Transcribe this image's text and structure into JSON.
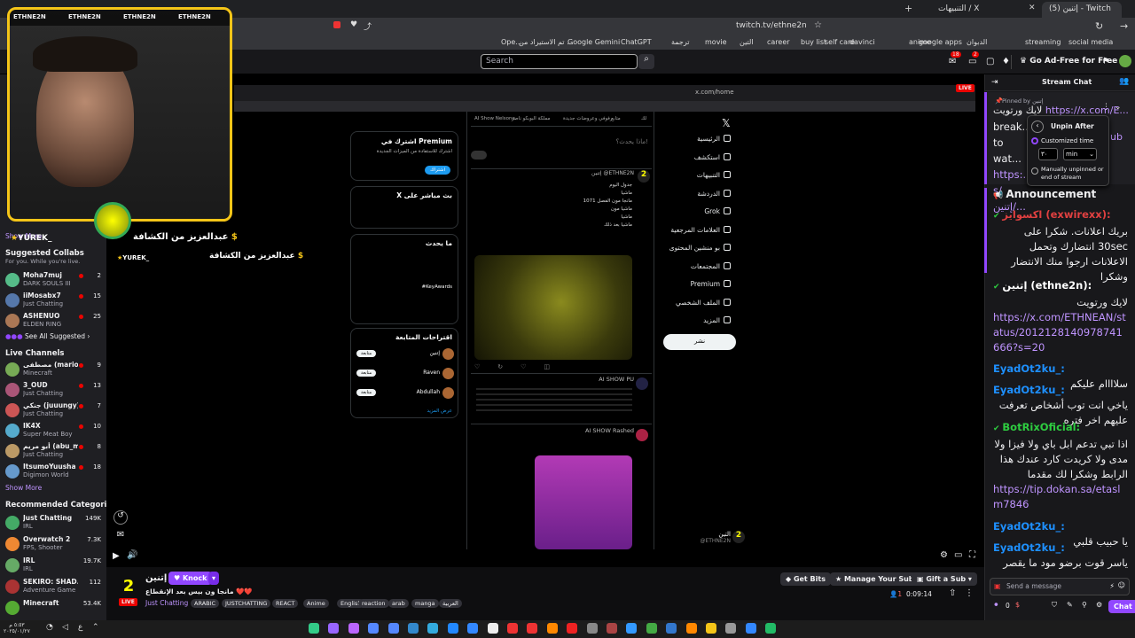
{
  "browser": {
    "tabs": [
      {
        "label": "(5) إتنين - Twitch",
        "active": true
      },
      {
        "label": "التنبيهات / X",
        "active": false
      }
    ],
    "url": "twitch.tv/ethne2n",
    "bookmarks": [
      "social media",
      "streaming",
      "الدبوان",
      "google apps",
      "anime",
      "davinci",
      "self care",
      "buy list",
      "career",
      "التين",
      "movie",
      "ترجمة",
      "ChatGPT",
      "Google Gemini",
      "تم الاستيراد من ...",
      "Ope..."
    ]
  },
  "twitch_header": {
    "search_placeholder": "Search",
    "notifications_count": "18",
    "whispers_count": "2",
    "ad_free_label": "Go Ad-Free for Free"
  },
  "sidebar": {
    "show_more_top": "Show More",
    "suggested_title": "Suggested Collabs",
    "suggested_sub": "For you. While you're live.",
    "suggested": [
      {
        "name": "Moha7muj",
        "game": "DARK SOULS III",
        "count": "2",
        "color": "#5b8"
      },
      {
        "name": "iiMosabx7",
        "game": "Just Chatting",
        "count": "15",
        "color": "#57a"
      },
      {
        "name": "ASHENUO",
        "game": "ELDEN RING",
        "count": "25",
        "color": "#a75"
      }
    ],
    "see_all": "See All Suggested",
    "live_title": "Live Channels",
    "live": [
      {
        "name": "مصطفى (mariona...)",
        "game": "Minecraft",
        "count": "9",
        "color": "#7a5"
      },
      {
        "name": "3_OUD",
        "game": "Just Chatting",
        "count": "13",
        "color": "#a57"
      },
      {
        "name": "جنكي (juuungy)",
        "game": "Just Chatting",
        "count": "7",
        "color": "#c55"
      },
      {
        "name": "IK4X",
        "game": "Super Meat Boy",
        "count": "10",
        "color": "#5ac"
      },
      {
        "name": "أبو مريم (abu_m...)",
        "game": "Just Chatting",
        "count": "8",
        "color": "#b96"
      },
      {
        "name": "ItsumoYuusha",
        "game": "Digimon World",
        "count": "18",
        "color": "#69c"
      }
    ],
    "show_more": "Show More",
    "rec_title": "Recommended Categories",
    "categories": [
      {
        "name": "Just Chatting",
        "game": "IRL",
        "count": "149K",
        "color": "#4a6"
      },
      {
        "name": "Overwatch 2",
        "game": "FPS, Shooter",
        "count": "7.3K",
        "color": "#e83"
      },
      {
        "name": "IRL",
        "game": "IRL",
        "count": "19.7K",
        "color": "#6a6"
      },
      {
        "name": "SEKIRO: SHAD...",
        "game": "Adventure Game",
        "count": "112",
        "color": "#a33"
      },
      {
        "name": "Minecraft",
        "game": "",
        "count": "53.4K",
        "color": "#5a3"
      }
    ]
  },
  "stream": {
    "webcam_names": [
      "ETHNE2N",
      "ETHNE2N",
      "ETHNE2N",
      "ETHNE2N"
    ],
    "overlay_text_1": "عبدالعزيز من الكشافة",
    "overlay_text_2": "عبدالعزيز من الكشافة",
    "overlay_user": "YUREK_",
    "overlay_user_2": "YUREK_",
    "vid_url": "x.com/home",
    "vid_live": "LIVE",
    "x_nav": [
      "الرئيسية",
      "استكشف",
      "التنبيهات",
      "الدردشة",
      "Grok",
      "العلامات المرجعية",
      "بو منشين المحتوى",
      "المجتمعات",
      "Premium",
      "الملف الشخصي",
      "المزيد"
    ],
    "x_post_button": "نشر",
    "x_tabs": [
      "لك",
      "متابع",
      "رفوفي وعروضات جديدة",
      "مملكة البوبكو ناصر",
      "AI Show Nelsone"
    ],
    "x_compose": "ماذا يحدث؟!",
    "x_post1_name": "إتنين @ETHNE2N",
    "x_post1_lines": [
      "جدول اليوم",
      "ماشيا",
      "مانجا مون الفصل 1071",
      "ماشيا مون",
      "ماشيا",
      "ماشيا بعد ذلك"
    ],
    "x_post2_name": "AI SHOW PU",
    "x_post3_name": "AI SHOW Rashed",
    "x_premium_title": "اشترك في Premium",
    "x_premium_text": "اشترك للاستفادة من الميزات الجديدة",
    "x_subscribe": "اشتراك",
    "x_live_title": "X بث مباشر على",
    "x_trends_title": "ما يحدث",
    "x_trend1": "#KeyAwards",
    "x_follow_title": "اقتراحات المتابعة",
    "x_follow": [
      "إتنين",
      "Raven",
      "Abdullah"
    ],
    "x_follow_btn": "متابعة",
    "x_show_more": "عرض المزيد",
    "x_streamer_name": "التين",
    "x_streamer_handle": "@ETHNE2N"
  },
  "info": {
    "viewers_rank": "2",
    "live": "LIVE",
    "channel_name": "إتنين",
    "knock": "Knock",
    "title": "مانجا ون بيس بعد الإنقطاع ❤️❤️",
    "category": "Just Chatting",
    "tags": [
      "ARABIC",
      "JUSTCHATTING",
      "REACT",
      "Anime",
      "English",
      "reaction",
      "arab",
      "manga",
      "العربية"
    ],
    "get_bits": "Get Bits",
    "manage_sub": "Manage Your Sub",
    "gift_sub": "Gift a Sub",
    "viewer_count": "1",
    "uptime": "0:09:14"
  },
  "chat": {
    "header": "Stream Chat",
    "pinned_by": "Pinned by إتنين",
    "pinned_text": "لايك ورتويت",
    "pinned_link": "https://x.com/E...",
    "pinned_lines": [
      "break...",
      "to wat...",
      "https:...",
      "s/إتنين/..."
    ],
    "popover_title": "Unpin After",
    "popover_opt1": "Customized time",
    "popover_num": "٣٠",
    "popover_unit": "min",
    "popover_opt2": "Manually unpinned or end of stream",
    "announcement": "Announcement",
    "messages": [
      {
        "user": "اكسوايز (exwirexx):",
        "user_color": "#e04040",
        "text": "بريك اعلانات. شكرا على 30sec انتضارك وتحمل الاعلانات ارجوا منك الانتضار وشكرا",
        "link": ""
      },
      {
        "user": "إتنين (ethne2n):",
        "user_color": "#ffffff",
        "text": "لايك ورتويت",
        "link": "https://x.com/ETHNEAN/status/2012128140978741666?s=20"
      },
      {
        "user": "EyadOt2ku_:",
        "user_color": "#1e90ff",
        "text": "سلاااام عليكم",
        "link": ""
      },
      {
        "user": "EyadOt2ku_:",
        "user_color": "#1e90ff",
        "text": "ياخي انت توب أشخاص تعرفت عليهم اخر فتره",
        "link": ""
      },
      {
        "user": "BotRixOficial:",
        "user_color": "#2ecc40",
        "text": "اذا تبي تدعم ابل باي ولا فيزا ولا مدى ولا كريدت كارد عندك هذا الرابط وشكرا لك مقدما",
        "link": "https://tip.dokan.sa/etaslm7846"
      },
      {
        "user": "EyadOt2ku_:",
        "user_color": "#1e90ff",
        "text": "يا حبيب قلبي",
        "link": ""
      },
      {
        "user": "EyadOt2ku_:",
        "user_color": "#1e90ff",
        "text": "ياسر قوت برضو مود ما يقصر",
        "link": ""
      }
    ],
    "input_placeholder": "Send a message",
    "points": "0",
    "chat_button": "Chat"
  },
  "taskbar": {
    "time": "٥:٥٣ م",
    "date": "٢٠٢٥/٠١/٢٧"
  },
  "colors": {
    "accent": "#9147ff",
    "live_red": "#eb0400",
    "link": "#bf94ff",
    "webcam_border": "#f5c518"
  }
}
